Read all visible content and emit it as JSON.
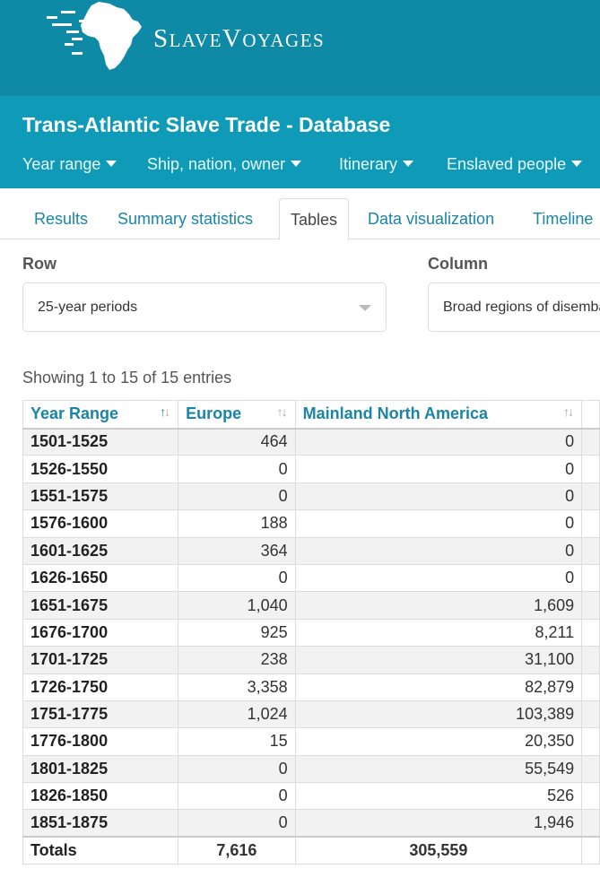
{
  "colors": {
    "header_bg": "#0f8aa6",
    "dbbar_bg": "#0f9bb8",
    "link": "#1a85a6"
  },
  "site": {
    "brand_first_initial": "S",
    "brand_first_rest": "LAVE",
    "brand_second_initial": "V",
    "brand_second_rest": "OYAGES",
    "logo_icon": "africa-map-logo"
  },
  "database": {
    "title": "Trans-Atlantic Slave Trade - Database",
    "menus": [
      "Year range",
      "Ship, nation, owner",
      "Itinerary",
      "Enslaved people"
    ]
  },
  "tabs": [
    "Results",
    "Summary statistics",
    "Tables",
    "Data visualization",
    "Timeline"
  ],
  "active_tab": "Tables",
  "controls": {
    "row_label": "Row",
    "row_value": "25-year periods",
    "column_label": "Column",
    "column_value": "Broad regions of disembarkation"
  },
  "showing_text": "Showing 1 to 15 of 15 entries",
  "table": {
    "headers": [
      "Year Range",
      "Europe",
      "Mainland North America"
    ],
    "rows": [
      [
        "1501-1525",
        "464",
        "0"
      ],
      [
        "1526-1550",
        "0",
        "0"
      ],
      [
        "1551-1575",
        "0",
        "0"
      ],
      [
        "1576-1600",
        "188",
        "0"
      ],
      [
        "1601-1625",
        "364",
        "0"
      ],
      [
        "1626-1650",
        "0",
        "0"
      ],
      [
        "1651-1675",
        "1,040",
        "1,609"
      ],
      [
        "1676-1700",
        "925",
        "8,211"
      ],
      [
        "1701-1725",
        "238",
        "31,100"
      ],
      [
        "1726-1750",
        "3,358",
        "82,879"
      ],
      [
        "1751-1775",
        "1,024",
        "103,389"
      ],
      [
        "1776-1800",
        "15",
        "20,350"
      ],
      [
        "1801-1825",
        "0",
        "55,549"
      ],
      [
        "1826-1850",
        "0",
        "526"
      ],
      [
        "1851-1875",
        "0",
        "1,946"
      ]
    ],
    "totals": [
      "Totals",
      "7,616",
      "305,559"
    ]
  }
}
